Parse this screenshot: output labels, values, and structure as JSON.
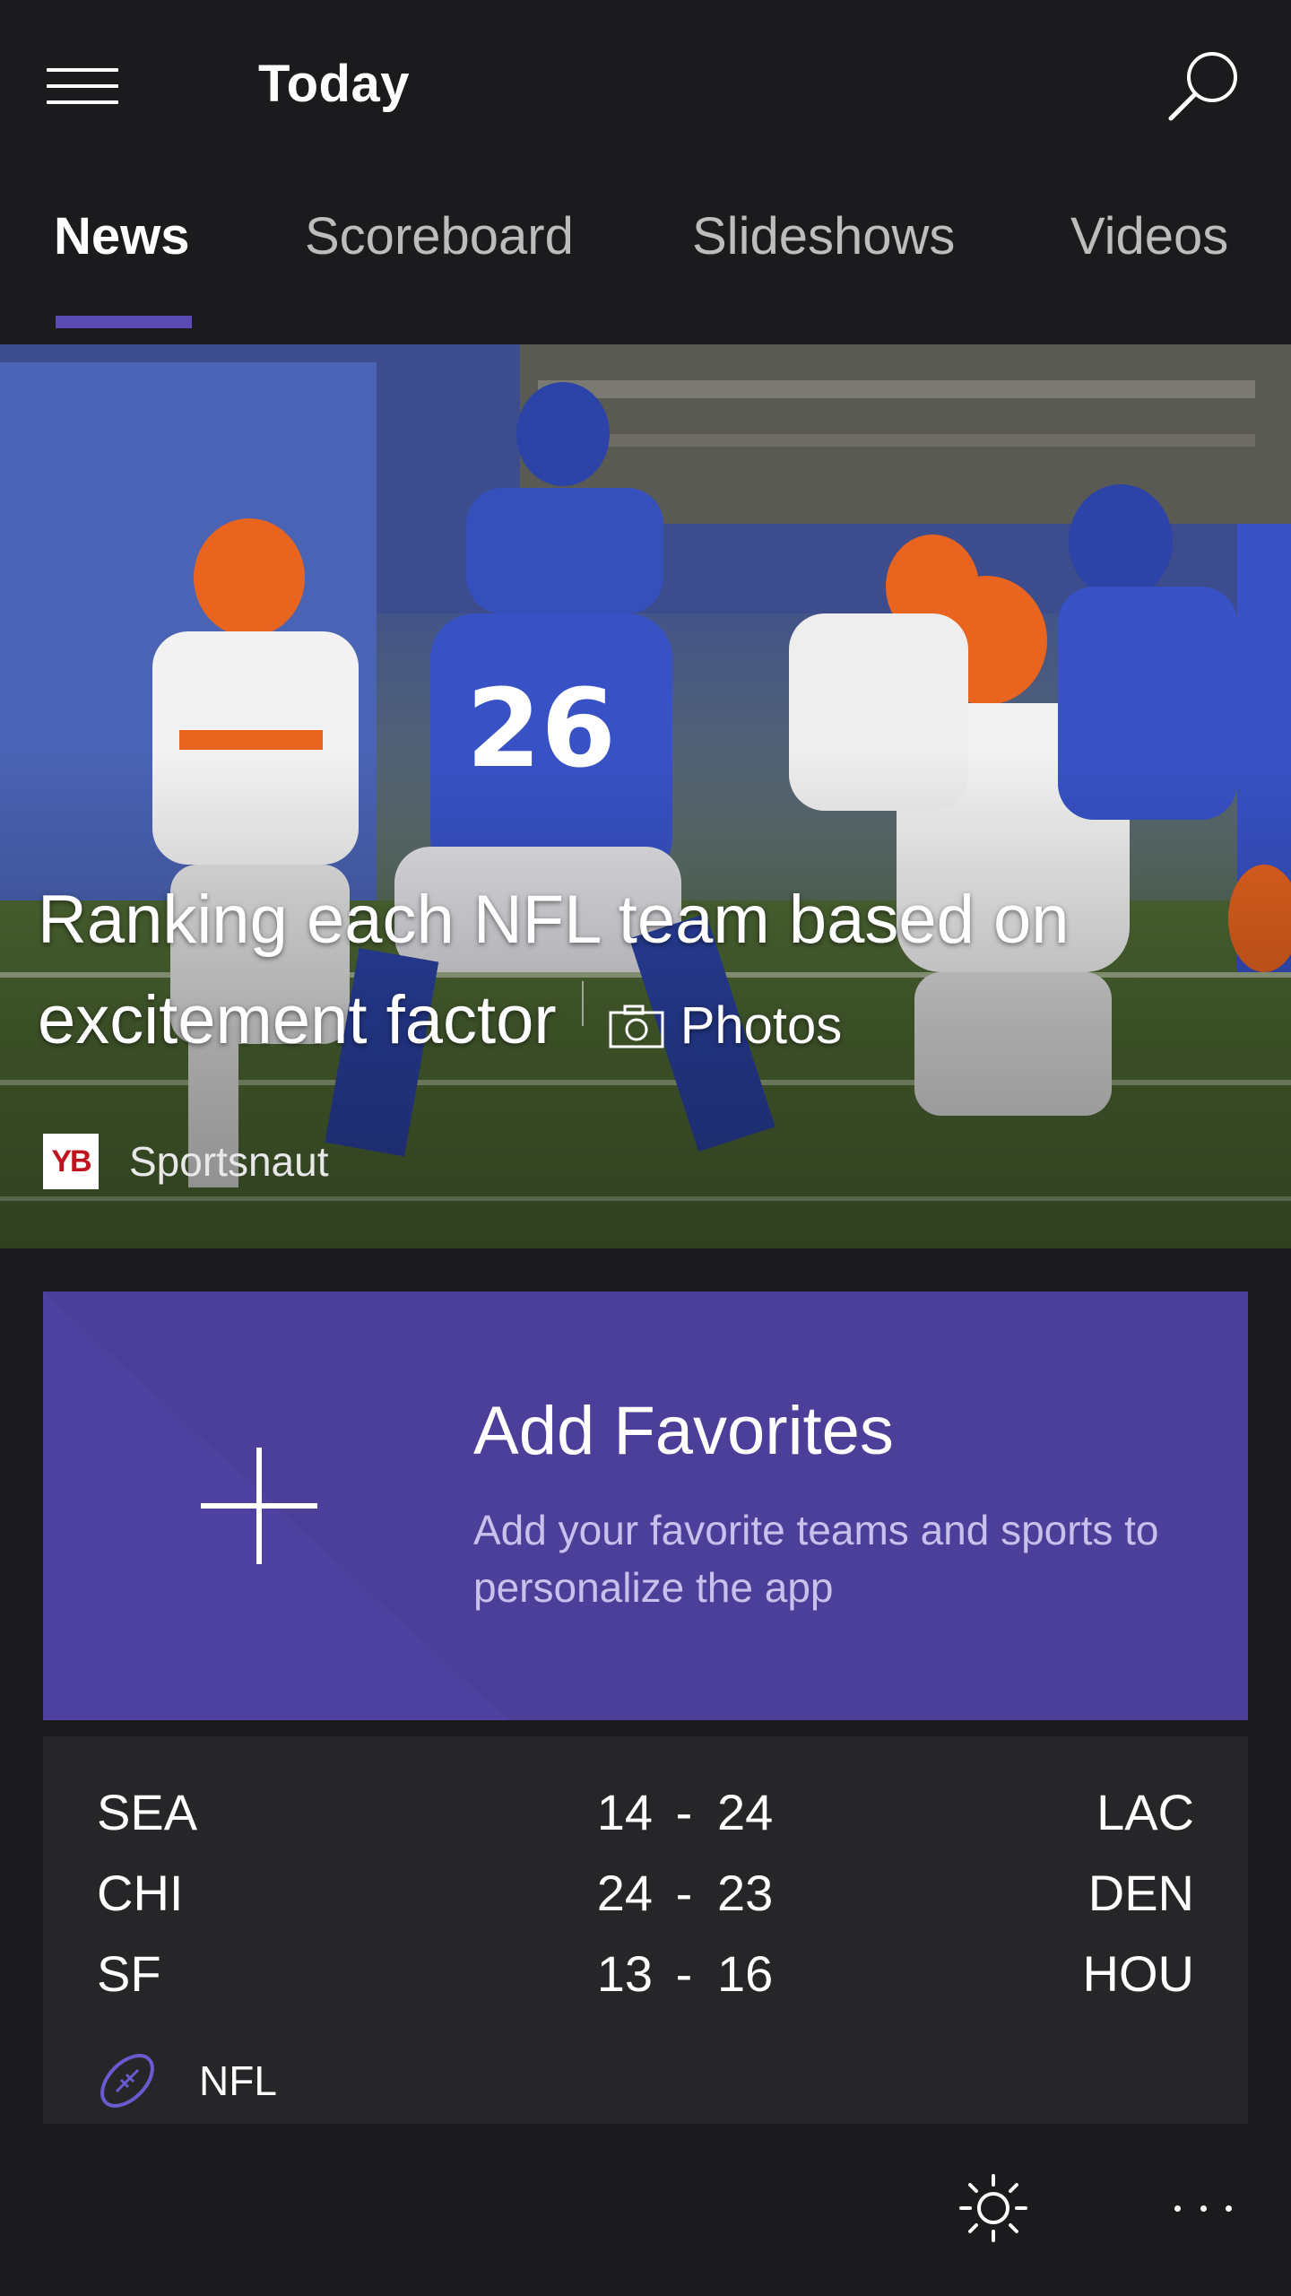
{
  "header": {
    "title": "Today",
    "menu_icon": "hamburger-menu-icon",
    "search_icon": "search-icon"
  },
  "tabs": [
    {
      "label": "News",
      "active": true
    },
    {
      "label": "Scoreboard",
      "active": false
    },
    {
      "label": "Slideshows",
      "active": false
    },
    {
      "label": "Videos",
      "active": false
    }
  ],
  "hero": {
    "headline": "Ranking each NFL team based on excitement factor",
    "media_label": "Photos",
    "media_icon": "camera-icon",
    "source_logo_text": "YB",
    "source_name": "Sportsnaut"
  },
  "favorites": {
    "title": "Add Favorites",
    "subtitle": "Add your favorite teams and sports to personalize the app",
    "icon": "plus-icon"
  },
  "scores": {
    "games": [
      {
        "home": "SEA",
        "home_score": "14",
        "away_score": "24",
        "away": "LAC"
      },
      {
        "home": "CHI",
        "home_score": "24",
        "away_score": "23",
        "away": "DEN"
      },
      {
        "home": "SF",
        "home_score": "13",
        "away_score": "16",
        "away": "HOU"
      }
    ],
    "separator": "-",
    "league": "NFL",
    "league_icon": "football-icon"
  },
  "appbar": {
    "theme_icon": "brightness-icon",
    "more_icon": "more-icon"
  },
  "colors": {
    "accent": "#5b4bb5",
    "favorites_bg": "#4b3f9a",
    "background": "#1b1b1d",
    "card_bg": "#262629"
  }
}
